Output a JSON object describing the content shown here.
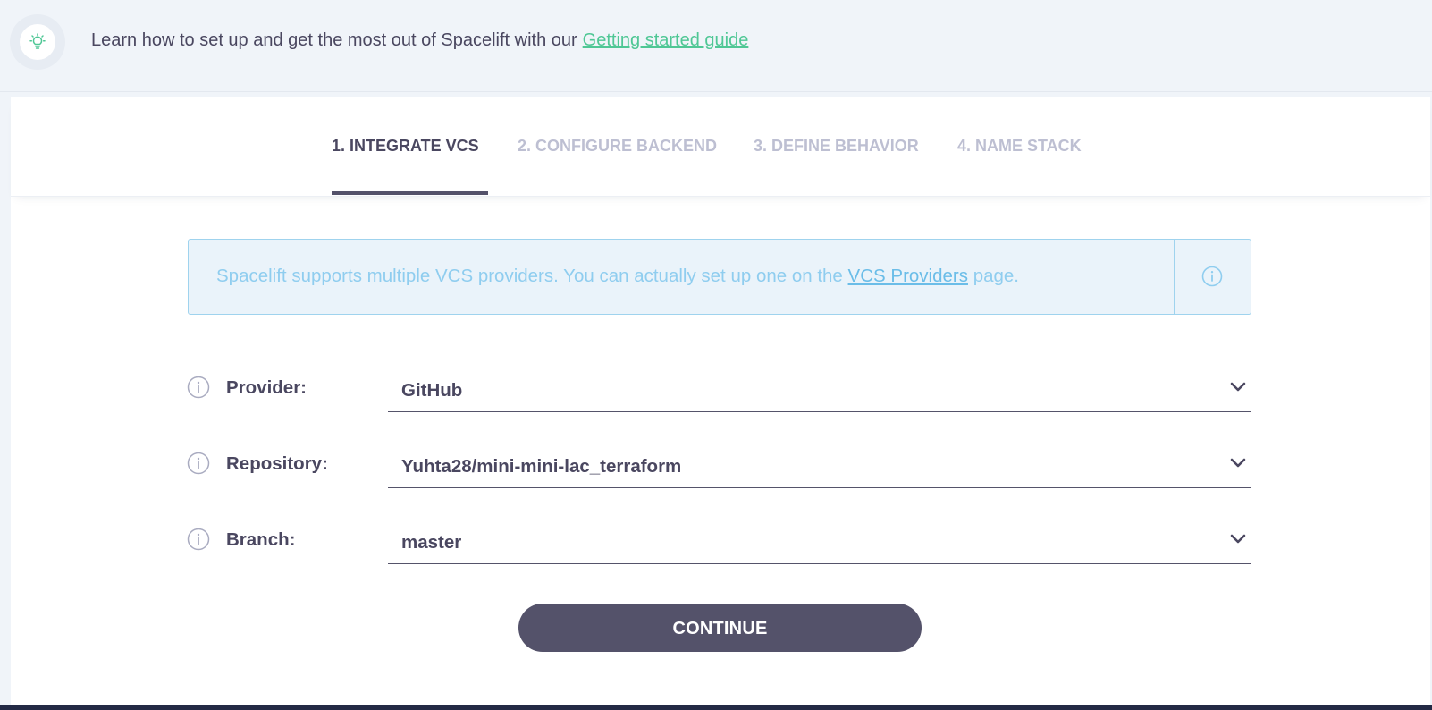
{
  "banner": {
    "text": "Learn how to set up and get the most out of Spacelift with our",
    "link": "Getting started guide",
    "icon": "lightbulb-icon"
  },
  "tabs": [
    {
      "label": "1. INTEGRATE VCS",
      "active": true
    },
    {
      "label": "2. CONFIGURE BACKEND",
      "active": false
    },
    {
      "label": "3. DEFINE BEHAVIOR",
      "active": false
    },
    {
      "label": "4. NAME STACK",
      "active": false
    }
  ],
  "info": {
    "text_before": "Spacelift supports multiple VCS providers. You can actually set up one on the",
    "link": "VCS Providers",
    "text_after": "page."
  },
  "form": {
    "provider": {
      "label": "Provider:",
      "value": "GitHub"
    },
    "repository": {
      "label": "Repository:",
      "value": "Yuhta28/mini-mini-lac_terraform"
    },
    "branch": {
      "label": "Branch:",
      "value": "master"
    }
  },
  "continue_label": "CONTINUE",
  "colors": {
    "accent_green": "#4fc795",
    "primary_button": "#54526a",
    "info_text": "#8fcdef",
    "info_border": "#9fd3ee"
  }
}
